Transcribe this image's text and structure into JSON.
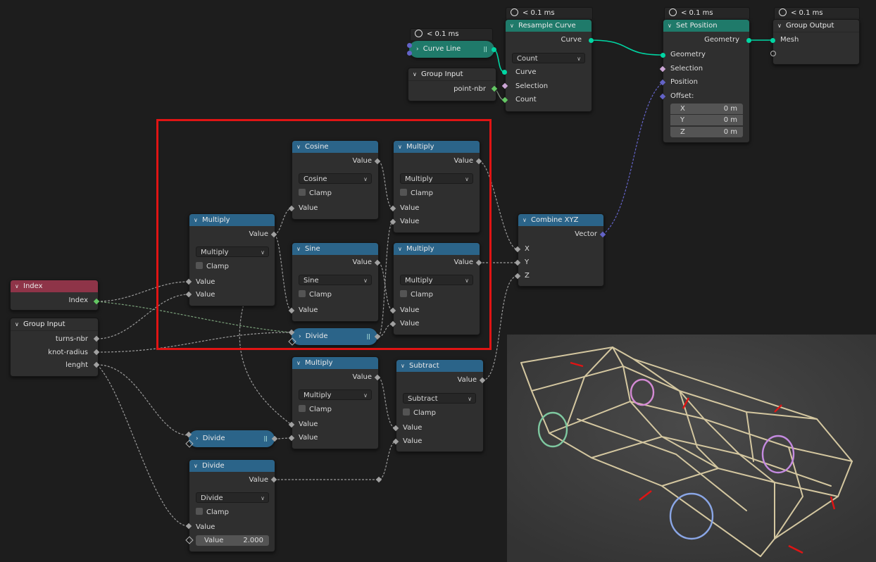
{
  "nodes": {
    "curve_line": {
      "timer": "< 0.1 ms",
      "title": "Curve Line"
    },
    "resample": {
      "timer": "< 0.1 ms",
      "title": "Resample Curve",
      "out_curve": "Curve",
      "mode": "Count",
      "in_curve": "Curve",
      "in_selection": "Selection",
      "in_count": "Count"
    },
    "group_input_top": {
      "title": "Group Input",
      "out": "point-nbr"
    },
    "set_position": {
      "timer": "< 0.1 ms",
      "title": "Set Position",
      "out_geometry": "Geometry",
      "in_geometry": "Geometry",
      "in_selection": "Selection",
      "in_position": "Position",
      "in_offset": "Offset:",
      "x_label": "X",
      "x_val": "0 m",
      "y_label": "Y",
      "y_val": "0 m",
      "z_label": "Z",
      "z_val": "0 m"
    },
    "group_output": {
      "timer": "< 0.1 ms",
      "title": "Group Output",
      "in_mesh": "Mesh"
    },
    "cosine": {
      "title": "Cosine",
      "out": "Value",
      "op": "Cosine",
      "clamp": "Clamp",
      "in": "Value"
    },
    "mult_top": {
      "title": "Multiply",
      "out": "Value",
      "op": "Multiply",
      "clamp": "Clamp",
      "in1": "Value",
      "in2": "Value"
    },
    "mult_left": {
      "title": "Multiply",
      "out": "Value",
      "op": "Multiply",
      "clamp": "Clamp",
      "in1": "Value",
      "in2": "Value"
    },
    "sine": {
      "title": "Sine",
      "out": "Value",
      "op": "Sine",
      "clamp": "Clamp",
      "in": "Value"
    },
    "mult_mid": {
      "title": "Multiply",
      "out": "Value",
      "op": "Multiply",
      "clamp": "Clamp",
      "in1": "Value",
      "in2": "Value"
    },
    "divide_pill_top": {
      "title": "Divide"
    },
    "combine": {
      "title": "Combine XYZ",
      "out": "Vector",
      "x": "X",
      "y": "Y",
      "z": "Z"
    },
    "index": {
      "title": "Index",
      "out": "Index"
    },
    "group_input_left": {
      "title": "Group Input",
      "o1": "turns-nbr",
      "o2": "knot-radius",
      "o3": "lenght"
    },
    "mult_bottom": {
      "title": "Multiply",
      "out": "Value",
      "op": "Multiply",
      "clamp": "Clamp",
      "in1": "Value",
      "in2": "Value"
    },
    "subtract": {
      "title": "Subtract",
      "out": "Value",
      "op": "Subtract",
      "clamp": "Clamp",
      "in1": "Value",
      "in2": "Value"
    },
    "divide_pill_bottom": {
      "title": "Divide"
    },
    "divide_bottom": {
      "title": "Divide",
      "out": "Value",
      "op": "Divide",
      "clamp": "Clamp",
      "in1": "Value",
      "in2_label": "Value",
      "in2_val": "2.000"
    }
  },
  "colors": {
    "geometry": "#00d6a3",
    "vector": "#6363c7",
    "float": "#a1a1a1",
    "selection_box": "#e01414"
  },
  "icons": [
    "chevron-down-icon",
    "chevron-right-icon",
    "stopwatch-icon",
    "grip-icon",
    "dropdown-arrow-icon"
  ]
}
